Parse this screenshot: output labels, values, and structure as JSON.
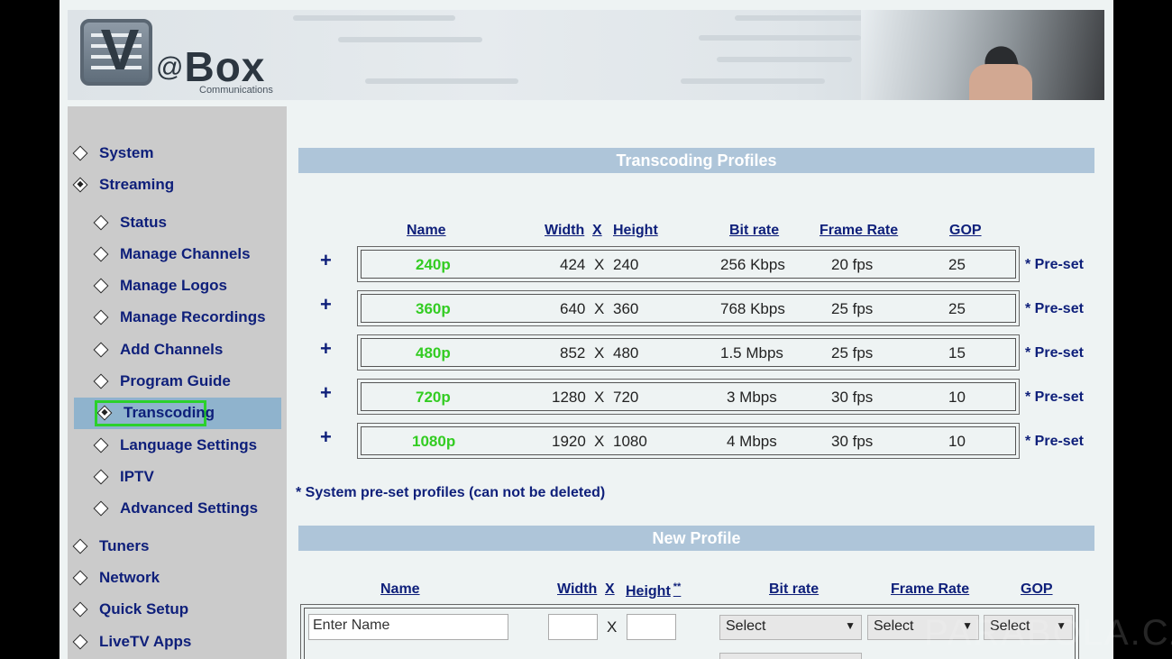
{
  "brand": {
    "name": "Box",
    "at": "@",
    "mark": "V",
    "sub": "Communications"
  },
  "sidebar": {
    "items": [
      {
        "label": "System"
      },
      {
        "label": "Streaming"
      },
      {
        "label": "Status"
      },
      {
        "label": "Manage Channels"
      },
      {
        "label": "Manage Logos"
      },
      {
        "label": "Manage Recordings"
      },
      {
        "label": "Add Channels"
      },
      {
        "label": "Program Guide"
      },
      {
        "label": "Transcoding"
      },
      {
        "label": "Language Settings"
      },
      {
        "label": "IPTV"
      },
      {
        "label": "Advanced Settings"
      },
      {
        "label": "Tuners"
      },
      {
        "label": "Network"
      },
      {
        "label": "Quick Setup"
      },
      {
        "label": "LiveTV Apps"
      }
    ],
    "active": "Transcoding"
  },
  "profiles": {
    "title": "Transcoding Profiles",
    "headers": {
      "name": "Name",
      "width": "Width",
      "x": "X",
      "height": "Height",
      "bitrate": "Bit rate",
      "framerate": "Frame Rate",
      "gop": "GOP"
    },
    "plus": "+",
    "rows": [
      {
        "name": "240p",
        "width": "424",
        "x": "X",
        "height": "240",
        "bitrate": "256 Kbps",
        "framerate": "20 fps",
        "gop": "25",
        "preset": "* Pre-set"
      },
      {
        "name": "360p",
        "width": "640",
        "x": "X",
        "height": "360",
        "bitrate": "768 Kbps",
        "framerate": "25 fps",
        "gop": "25",
        "preset": "* Pre-set"
      },
      {
        "name": "480p",
        "width": "852",
        "x": "X",
        "height": "480",
        "bitrate": "1.5 Mbps",
        "framerate": "25 fps",
        "gop": "15",
        "preset": "* Pre-set"
      },
      {
        "name": "720p",
        "width": "1280",
        "x": "X",
        "height": "720",
        "bitrate": "3 Mbps",
        "framerate": "30 fps",
        "gop": "10",
        "preset": "* Pre-set"
      },
      {
        "name": "1080p",
        "width": "1920",
        "x": "X",
        "height": "1080",
        "bitrate": "4 Mbps",
        "framerate": "30 fps",
        "gop": "10",
        "preset": "* Pre-set"
      }
    ],
    "note": "* System pre-set profiles (can not be deleted)"
  },
  "new_profile": {
    "title": "New Profile",
    "headers": {
      "name": "Name",
      "width": "Width",
      "x": "X",
      "height": "Height",
      "height_mark": "**",
      "bitrate": "Bit rate",
      "framerate": "Frame Rate",
      "gop": "GOP"
    },
    "name_value": "Enter Name",
    "x": "X",
    "bitrate_select": "Select",
    "framerate_select": "Select",
    "gop_select": "Select"
  },
  "watermark": "PARABOLA.CZ",
  "colors": {
    "nav_text": "#0e1f7a",
    "preset_name": "#33cc22",
    "section_bar": "#aec5d9",
    "active_bg": "#8fb3cd",
    "active_outline": "#2bd12b"
  }
}
